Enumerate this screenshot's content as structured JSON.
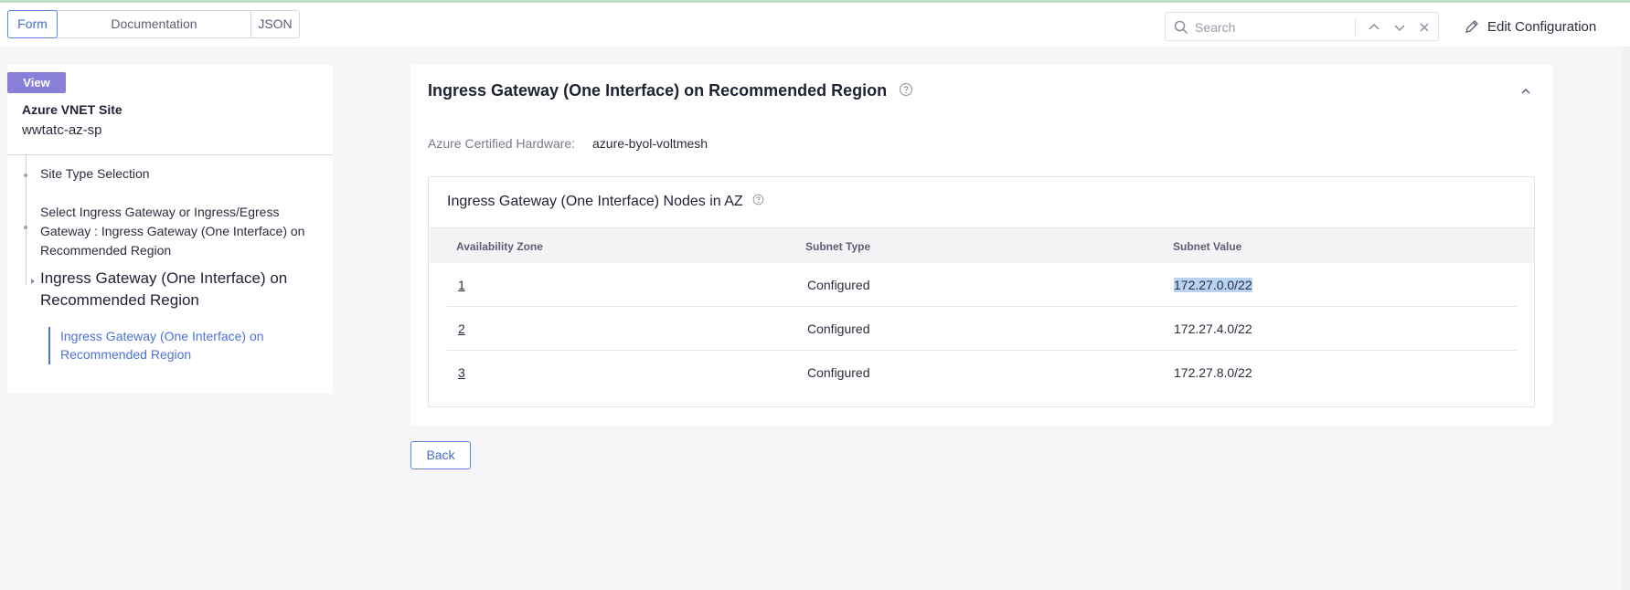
{
  "tabs": [
    {
      "label": "Form",
      "active": true
    },
    {
      "label": "Documentation",
      "active": false
    },
    {
      "label": "JSON",
      "active": false
    }
  ],
  "search": {
    "placeholder": "Search",
    "value": ""
  },
  "toolbar": {
    "edit_label": "Edit Configuration"
  },
  "sidebar": {
    "badge": "View",
    "title": "Azure VNET Site",
    "subtitle": "wwtatc-az-sp",
    "items": [
      {
        "label": "Site Type Selection"
      },
      {
        "label": "Select Ingress Gateway or Ingress/Egress Gateway : Ingress Gateway (One Interface) on Recommended Region"
      },
      {
        "label": "Ingress Gateway (One Interface) on Recommended Region",
        "current": true
      }
    ],
    "sub_item": "Ingress Gateway (One Interface) on Recommended Region"
  },
  "main": {
    "title": "Ingress Gateway (One Interface) on Recommended Region",
    "hardware_label": "Azure Certified Hardware:",
    "hardware_value": "azure-byol-voltmesh",
    "nodes": {
      "title": "Ingress Gateway (One Interface) Nodes in AZ",
      "columns": [
        "Availability Zone",
        "Subnet Type",
        "Subnet Value"
      ],
      "rows": [
        {
          "zone": "1",
          "type": "Configured",
          "value": "172.27.0.0/22",
          "selected": true
        },
        {
          "zone": "2",
          "type": "Configured",
          "value": "172.27.4.0/22",
          "selected": false
        },
        {
          "zone": "3",
          "type": "Configured",
          "value": "172.27.8.0/22",
          "selected": false
        }
      ]
    }
  },
  "footer": {
    "back_label": "Back"
  },
  "colors": {
    "accent": "#3f6fd1",
    "badge": "#8a7fd8",
    "selection": "#b9d3f3"
  },
  "icons": [
    "search-icon",
    "chevron-up-icon",
    "chevron-down-icon",
    "close-icon",
    "pencil-icon",
    "help-icon",
    "collapse-chevron-icon"
  ]
}
